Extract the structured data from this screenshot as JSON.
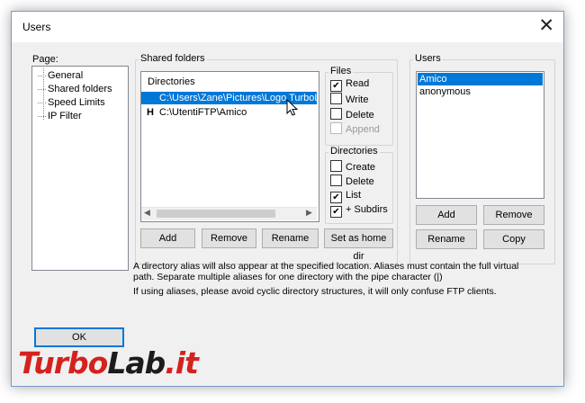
{
  "window": {
    "title": "Users",
    "close_glyph": "✕"
  },
  "page_panel": {
    "label": "Page:",
    "items": [
      "General",
      "Shared folders",
      "Speed Limits",
      "IP Filter"
    ]
  },
  "shared_folders": {
    "group_label": "Shared folders",
    "list_header": "Directories",
    "rows": [
      {
        "prefix": "",
        "path": "C:\\Users\\Zane\\Pictures\\Logo TurboLa",
        "selected": true
      },
      {
        "prefix": "H",
        "path": "C:\\UtentiFTP\\Amico",
        "selected": false
      }
    ],
    "buttons": {
      "add": "Add",
      "remove": "Remove",
      "rename": "Rename",
      "set_home": "Set as home dir"
    }
  },
  "files_group": {
    "label": "Files",
    "options": [
      {
        "label": "Read",
        "checked": true,
        "disabled": false
      },
      {
        "label": "Write",
        "checked": false,
        "disabled": false
      },
      {
        "label": "Delete",
        "checked": false,
        "disabled": false
      },
      {
        "label": "Append",
        "checked": false,
        "disabled": true
      }
    ]
  },
  "directories_group": {
    "label": "Directories",
    "options": [
      {
        "label": "Create",
        "checked": false
      },
      {
        "label": "Delete",
        "checked": false
      },
      {
        "label": "List",
        "checked": true
      },
      {
        "label": "+ Subdirs",
        "checked": true
      }
    ]
  },
  "users_panel": {
    "group_label": "Users",
    "users": [
      {
        "name": "Amico",
        "selected": true
      },
      {
        "name": "anonymous",
        "selected": false
      }
    ],
    "buttons": {
      "add": "Add",
      "remove": "Remove",
      "rename": "Rename",
      "copy": "Copy"
    }
  },
  "info_text": {
    "line1": "A directory alias will also appear at the specified location. Aliases must contain the full virtual",
    "line2": "path. Separate multiple aliases for one directory with the pipe character (|)",
    "line3": "If using aliases, please avoid cyclic directory structures, it will only confuse FTP clients."
  },
  "footer": {
    "ok_label": "OK"
  },
  "watermark": {
    "part1": "Turbo",
    "part2": "Lab",
    "part3": ".it"
  },
  "colors": {
    "selection": "#0078d7",
    "accent_red": "#d4221f"
  }
}
